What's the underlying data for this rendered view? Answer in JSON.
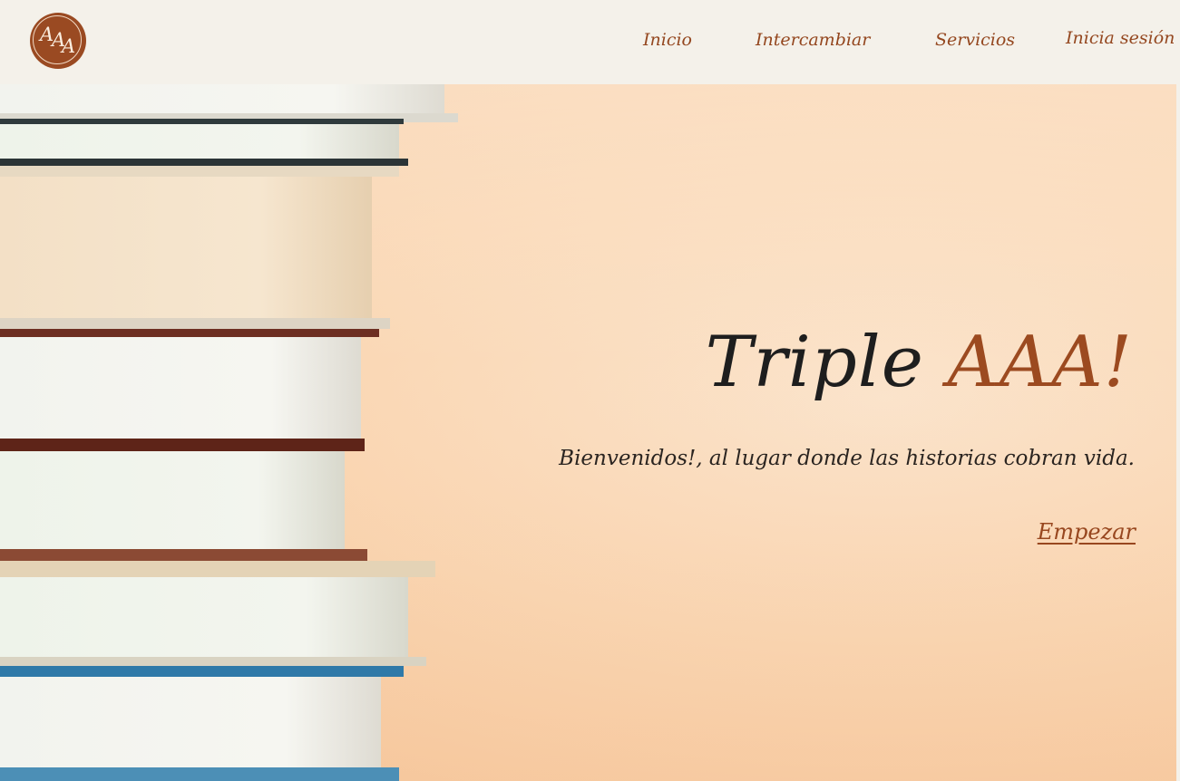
{
  "brand": {
    "logo_text": "AAA",
    "logo_color": "#9a4a22"
  },
  "nav": {
    "items": [
      {
        "label": "Inicio"
      },
      {
        "label": "Intercambiar"
      },
      {
        "label": "Servicios"
      },
      {
        "label": "Inicia sesión"
      }
    ]
  },
  "hero": {
    "title_main": "Triple ",
    "title_accent": "AAA!",
    "subtitle": "Bienvenidos!, al lugar donde las historias cobran vida.",
    "cta_label": "Empezar",
    "background_image": "stack-of-books-photo"
  },
  "colors": {
    "accent": "#9c4a20",
    "header_bg": "#f4f1ea",
    "text_dark": "#1e1e1e"
  }
}
